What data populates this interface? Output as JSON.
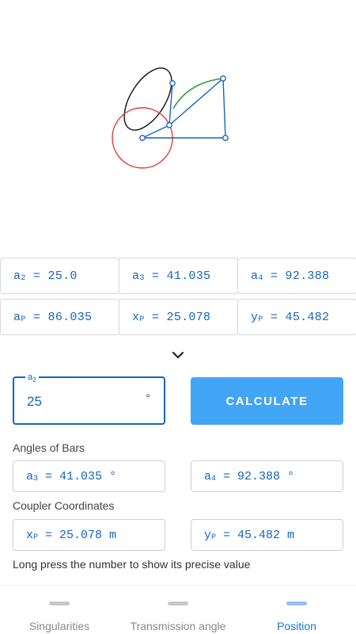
{
  "results": {
    "a2": "25.0",
    "a3": "41.035",
    "a4": "92.388",
    "aP": "86.035",
    "xP": "25.078",
    "yP": "45.482"
  },
  "input": {
    "label_main": "a",
    "label_sub": "2",
    "value": "25",
    "unit": "°"
  },
  "calculate_label": "CALCULATE",
  "angles_title": "Angles of Bars",
  "angles": {
    "a3": "41.035 °",
    "a4": "92.388 °"
  },
  "coupler_title": "Coupler Coordinates",
  "coupler": {
    "xP": "25.078 m",
    "yP": "45.482 m"
  },
  "hint": "Long press the number to show its precise value",
  "nav": [
    {
      "label": "Singularities"
    },
    {
      "label": "Transmission angle"
    },
    {
      "label": "Position"
    }
  ],
  "active_tab": "Position",
  "colors": {
    "accent": "#1565c0",
    "button": "#42a5f5",
    "linkage": "#1565c0",
    "circle": "#e53935",
    "ellipse": "#111111",
    "arc": "#2e9e3e"
  },
  "icons": [
    "chevron-down-icon"
  ]
}
